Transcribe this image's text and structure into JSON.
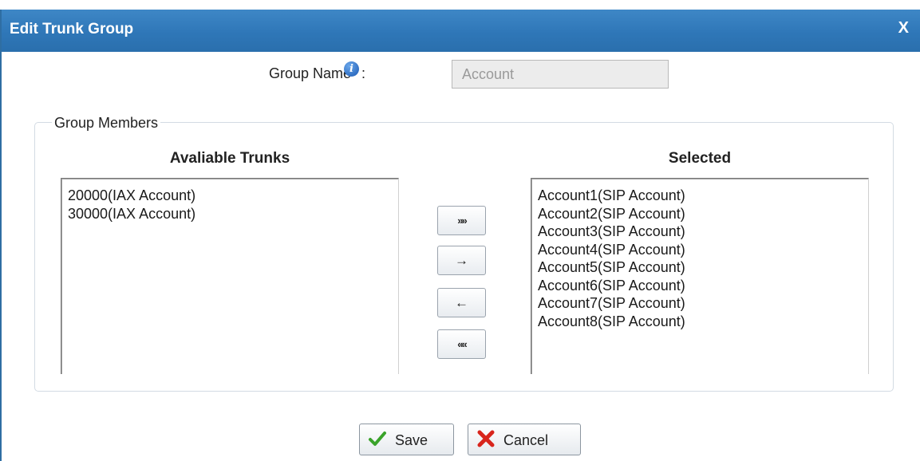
{
  "dialog": {
    "title": "Edit Trunk Group",
    "close_label": "X"
  },
  "group_name": {
    "label": "Group Name",
    "colon": ":",
    "value": "Account"
  },
  "group_members": {
    "legend": "Group Members",
    "available_header": "Avaliable Trunks",
    "selected_header": "Selected",
    "available": [
      "20000(IAX Account)",
      "30000(IAX Account)"
    ],
    "selected": [
      "Account1(SIP Account)",
      "Account2(SIP Account)",
      "Account3(SIP Account)",
      "Account4(SIP Account)",
      "Account5(SIP Account)",
      "Account6(SIP Account)",
      "Account7(SIP Account)",
      "Account8(SIP Account)"
    ],
    "buttons": {
      "add_all": "»»",
      "add_one": "→",
      "remove_one": "←",
      "remove_all": "««"
    }
  },
  "actions": {
    "save_label": "Save",
    "cancel_label": "Cancel"
  },
  "icons": {
    "info": "info-icon",
    "save": "checkmark-icon",
    "cancel": "red-x-icon"
  },
  "colors": {
    "titlebar": "#2f77b8",
    "save_check": "#3aa32a",
    "cancel_x": "#d8251c"
  }
}
